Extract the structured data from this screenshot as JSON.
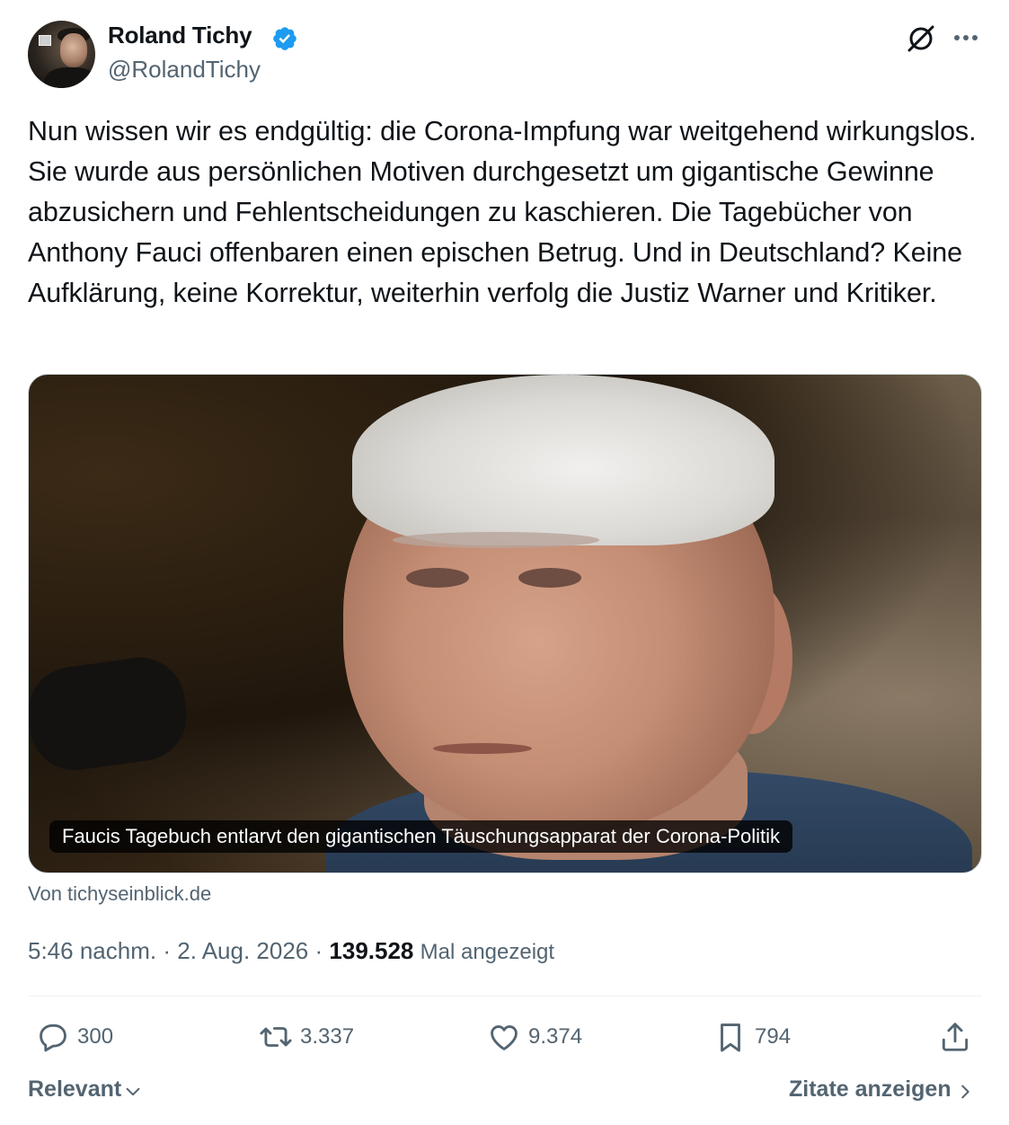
{
  "author": {
    "display_name": "Roland Tichy",
    "handle": "@RolandTichy",
    "verified": true,
    "verified_color": "#1d9bf0"
  },
  "icons": {
    "grok": "grok-icon",
    "more": "more-icon",
    "reply": "reply-icon",
    "retweet": "retweet-icon",
    "like": "heart-icon",
    "bookmark": "bookmark-icon",
    "share": "share-icon"
  },
  "tweet": {
    "text": "Nun wissen wir es endgültig: die Corona-Impfung war weitgehend wirkungslos. Sie wurde aus persönlichen Motiven durchgesetzt um gigantische Gewinne abzusichern und Fehlentscheidungen zu kaschieren. Die Tagebücher von Anthony Fauci offenbaren einen epischen Betrug. Und in Deutschland? Keine Aufklärung, keine Korrektur, weiterhin verfolg die Justiz Warner und Kritiker."
  },
  "card": {
    "caption": "Faucis Tagebuch entlarvt den gigantischen Täuschungsapparat der Corona-Politik",
    "source": "Von tichyseinblick.de"
  },
  "meta": {
    "time": "5:46 nachm.",
    "separator": "·",
    "date": "2. Aug. 2026",
    "views": "139.528",
    "views_label": "Mal angezeigt"
  },
  "actions": {
    "replies": "300",
    "retweets": "3.337",
    "likes": "9.374",
    "bookmarks": "794"
  },
  "footer": {
    "sort_label": "Relevant",
    "quotes_label": "Zitate anzeigen"
  }
}
